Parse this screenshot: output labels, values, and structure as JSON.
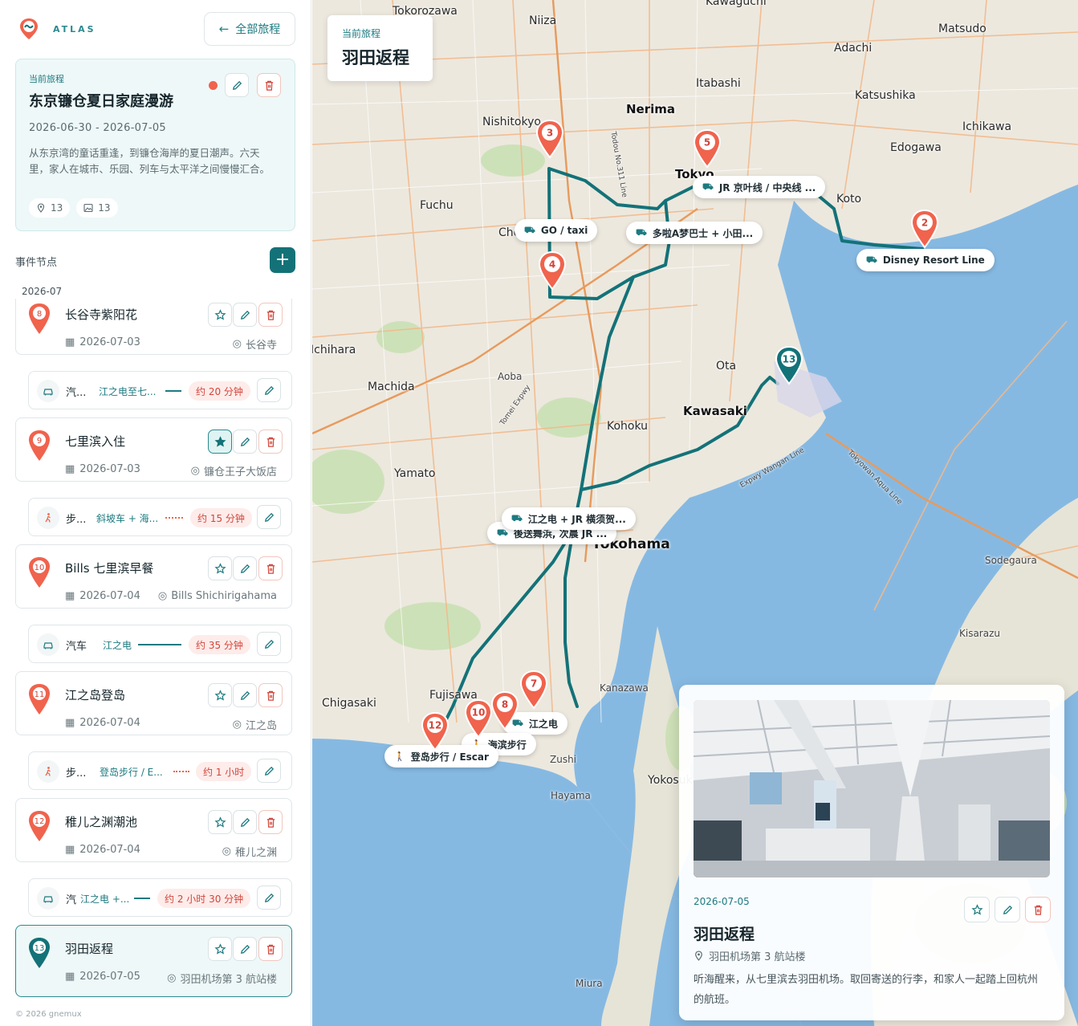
{
  "brand": {
    "name": "ATLAS"
  },
  "nav": {
    "back_label": "全部旅程"
  },
  "trip": {
    "kicker": "当前旅程",
    "title": "东京镰仓夏日家庭漫游",
    "dates": "2026-06-30 - 2026-07-05",
    "description": "从东京湾的童话重逢，到镰仓海岸的夏日潮声。六天里，家人在城市、乐园、列车与太平洋之间慢慢汇合。",
    "place_count": "13",
    "photo_count": "13"
  },
  "events_section": {
    "title": "事件节点",
    "month": "2026-07"
  },
  "events": [
    {
      "number": "8",
      "title": "长谷寺紫阳花",
      "date": "2026-07-03",
      "location": "长谷寺",
      "starred": false,
      "active": false
    },
    {
      "number": "9",
      "title": "七里滨入住",
      "date": "2026-07-03",
      "location": "镰仓王子大饭店",
      "starred": true,
      "active": false
    },
    {
      "number": "10",
      "title": "Bills 七里滨早餐",
      "date": "2026-07-04",
      "location": "Bills Shichirigahama",
      "starred": false,
      "active": false
    },
    {
      "number": "11",
      "title": "江之岛登岛",
      "date": "2026-07-04",
      "location": "江之岛",
      "starred": false,
      "active": false
    },
    {
      "number": "12",
      "title": "稚儿之渊潮池",
      "date": "2026-07-04",
      "location": "稚儿之渊",
      "starred": false,
      "active": false
    },
    {
      "number": "13",
      "title": "羽田返程",
      "date": "2026-07-05",
      "location": "羽田机场第 3 航站楼",
      "starred": false,
      "active": true
    }
  ],
  "transits": [
    {
      "mode": "汽...",
      "route": "江之电至七...",
      "duration": "约 20 分钟",
      "kind": "car"
    },
    {
      "mode": "步...",
      "route": "斜坡车 + 海...",
      "duration": "约 15 分钟",
      "kind": "walk"
    },
    {
      "mode": "汽车",
      "route": "江之电",
      "duration": "约 35 分钟",
      "kind": "car"
    },
    {
      "mode": "步...",
      "route": "登岛步行 / E...",
      "duration": "约 1 小时",
      "kind": "walk"
    },
    {
      "mode": "汽",
      "route": "江之电 +...",
      "duration": "约 2 小时 30 分钟",
      "kind": "car"
    }
  ],
  "footer": {
    "copyright": "© 2026 gnemux"
  },
  "map": {
    "current_trip_kicker": "当前旅程",
    "current_trip_title": "羽田返程",
    "place_labels": [
      "Tokorozawa",
      "Niiza",
      "Kawaguchi",
      "Matsudo",
      "Adachi",
      "Itabashi",
      "Nerima",
      "Katsushika",
      "Nishitokyo",
      "Ichikawa",
      "Edogawa",
      "Tokyo",
      "Koto",
      "Fuchu",
      "Chofu",
      "Ota",
      "Aoba",
      "Machida",
      "Kawasaki",
      "Kohoku",
      "Yamato",
      "Yokohama",
      "Sodegaura",
      "Kisarazu",
      "Kanazawa",
      "Chigasaki",
      "Fujisawa",
      "Zushi",
      "Yokosuka",
      "Hayama",
      "Miura",
      "Ichihara"
    ],
    "road_labels": [
      "Tomei Expwy",
      "Todou No.311 Line",
      "Tokyowan Aqua Line",
      "Expwy Wangan Line"
    ],
    "route_tags": [
      {
        "label": "GO / taxi",
        "kind": "car"
      },
      {
        "label": "JR 京叶线 / 中央线 ...",
        "kind": "car"
      },
      {
        "label": "多啦A梦巴士 + 小田...",
        "kind": "car"
      },
      {
        "label": "Disney Resort Line",
        "kind": "car"
      },
      {
        "label": "江之电 + JR 横须贺...",
        "kind": "car"
      },
      {
        "label": "後送舞浜, 次晨 JR ...",
        "kind": "car"
      },
      {
        "label": "江之电",
        "kind": "car"
      },
      {
        "label": "海滨步行",
        "kind": "walk"
      },
      {
        "label": "登岛步行 / Escar",
        "kind": "walk"
      }
    ],
    "pins": [
      "2",
      "3",
      "4",
      "5",
      "7",
      "8",
      "10",
      "12",
      "13"
    ],
    "colors": {
      "water": "#7fb6e0",
      "land": "#ece8de",
      "route": "#137278",
      "pin_red": "#f0634d",
      "pin_teal": "#137278"
    }
  },
  "detail": {
    "date": "2026-07-05",
    "title": "羽田返程",
    "location": "羽田机场第 3 航站楼",
    "description": "听海醒来，从七里滨去羽田机场。取回寄送的行李，和家人一起踏上回杭州的航班。"
  }
}
